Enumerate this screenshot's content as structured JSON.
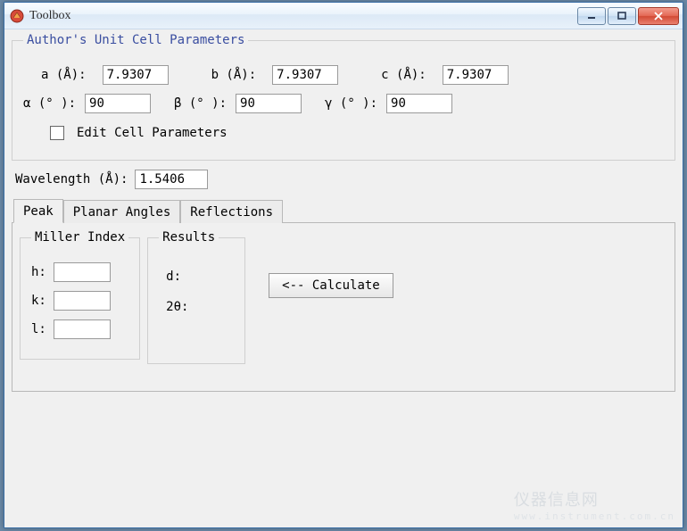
{
  "window": {
    "title": "Toolbox"
  },
  "cell": {
    "legend": "Author's Unit Cell Parameters",
    "a_label": "a (Å):",
    "a_value": "7.9307",
    "b_label": "b (Å):",
    "b_value": "7.9307",
    "c_label": "c (Å):",
    "c_value": "7.9307",
    "alpha_label": "α (° ):",
    "alpha_value": "90",
    "beta_label": "β (° ):",
    "beta_value": "90",
    "gamma_label": "γ (° ):",
    "gamma_value": "90",
    "edit_checkbox_label": "Edit Cell Parameters",
    "edit_checked": false
  },
  "wavelength": {
    "label": "Wavelength (Å):",
    "value": "1.5406"
  },
  "tabs": {
    "peak": "Peak",
    "planar": "Planar Angles",
    "refl": "Reflections",
    "active": "peak"
  },
  "peak": {
    "miller_legend": "Miller Index",
    "h_label": "h:",
    "h_value": "",
    "k_label": "k:",
    "k_value": "",
    "l_label": "l:",
    "l_value": "",
    "results_legend": "Results",
    "d_label": "d:",
    "d_value": "",
    "two_theta_label": "2θ:",
    "two_theta_value": "",
    "calculate": "<-- Calculate"
  },
  "watermark": {
    "line1": "仪器信息网",
    "line2": "www.instrument.com.cn"
  }
}
